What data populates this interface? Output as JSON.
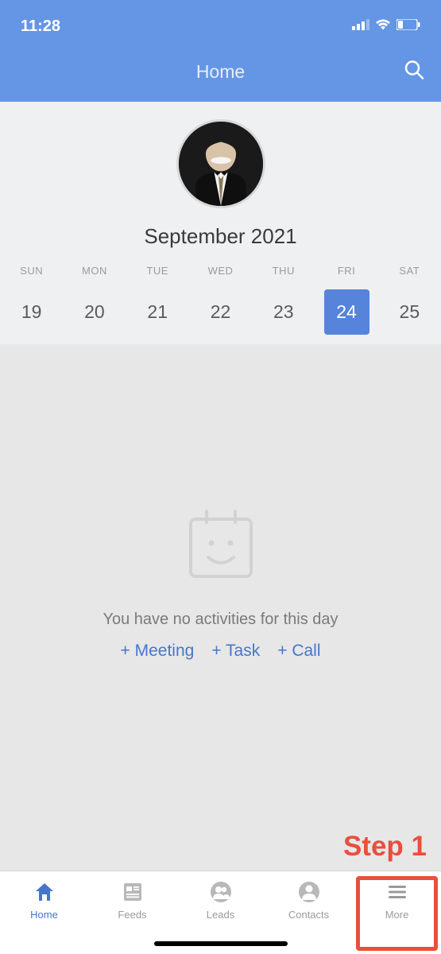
{
  "statusBar": {
    "time": "11:28"
  },
  "header": {
    "title": "Home"
  },
  "calendar": {
    "monthLabel": "September 2021",
    "days": [
      {
        "label": "SUN",
        "num": "19",
        "selected": false
      },
      {
        "label": "MON",
        "num": "20",
        "selected": false
      },
      {
        "label": "TUE",
        "num": "21",
        "selected": false
      },
      {
        "label": "WED",
        "num": "22",
        "selected": false
      },
      {
        "label": "THU",
        "num": "23",
        "selected": false
      },
      {
        "label": "FRI",
        "num": "24",
        "selected": true
      },
      {
        "label": "SAT",
        "num": "25",
        "selected": false
      }
    ]
  },
  "activities": {
    "emptyMessage": "You have no activities for this day",
    "actions": {
      "meeting": "+ Meeting",
      "task": "+ Task",
      "call": "+ Call"
    }
  },
  "tabs": [
    {
      "label": "Home",
      "active": true
    },
    {
      "label": "Feeds",
      "active": false
    },
    {
      "label": "Leads",
      "active": false
    },
    {
      "label": "Contacts",
      "active": false
    },
    {
      "label": "More",
      "active": false
    }
  ],
  "annotation": {
    "stepLabel": "Step 1"
  }
}
